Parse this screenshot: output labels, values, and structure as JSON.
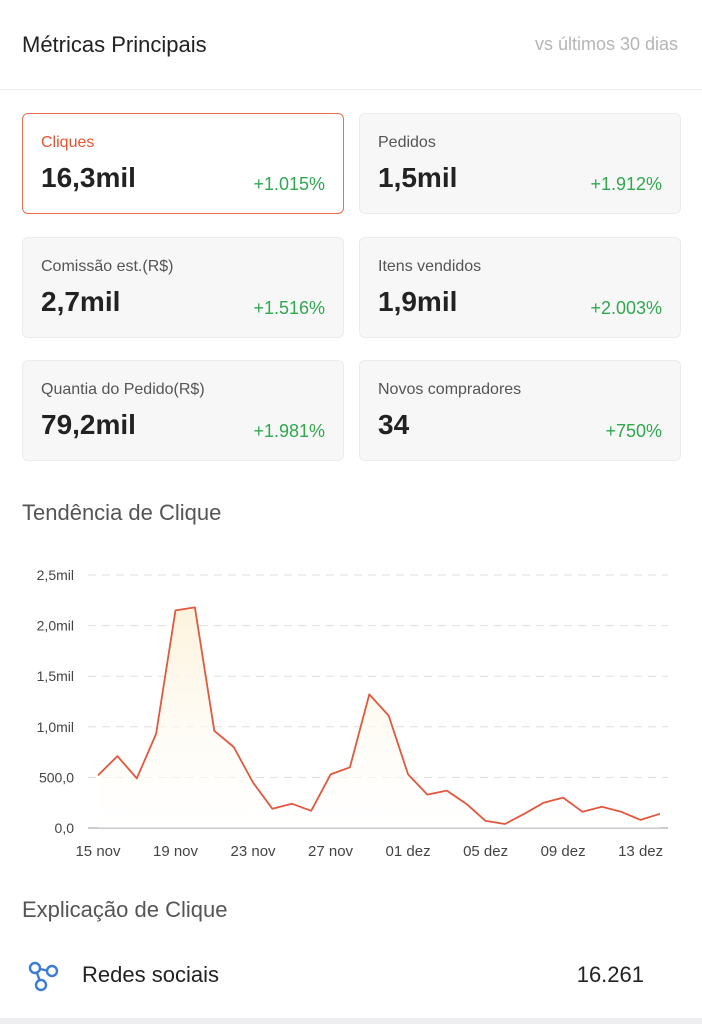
{
  "header": {
    "title": "Métricas Principais",
    "period": "vs últimos 30 dias"
  },
  "metrics": [
    {
      "label": "Cliques",
      "value": "16,3mil",
      "delta": "+1.015%",
      "active": true
    },
    {
      "label": "Pedidos",
      "value": "1,5mil",
      "delta": "+1.912%",
      "active": false
    },
    {
      "label": "Comissão est.(R$)",
      "value": "2,7mil",
      "delta": "+1.516%",
      "active": false
    },
    {
      "label": "Itens vendidos",
      "value": "1,9mil",
      "delta": "+2.003%",
      "active": false
    },
    {
      "label": "Quantia do Pedido(R$)",
      "value": "79,2mil",
      "delta": "+1.981%",
      "active": false
    },
    {
      "label": "Novos compradores",
      "value": "34",
      "delta": "+750%",
      "active": false
    }
  ],
  "trend": {
    "title": "Tendência de Clique"
  },
  "chart_data": {
    "type": "area",
    "title": "Tendência de Clique",
    "ylim": [
      0,
      2500
    ],
    "y_ticks": [
      {
        "value": 0,
        "label": "0,0"
      },
      {
        "value": 500,
        "label": "500,0"
      },
      {
        "value": 1000,
        "label": "1,0mil"
      },
      {
        "value": 1500,
        "label": "1,5mil"
      },
      {
        "value": 2000,
        "label": "2,0mil"
      },
      {
        "value": 2500,
        "label": "2,5mil"
      }
    ],
    "x_tick_labels": [
      "15 nov",
      "19 nov",
      "23 nov",
      "27 nov",
      "01 dez",
      "05 dez",
      "09 dez",
      "13 dez"
    ],
    "x_tick_index": [
      0,
      4,
      8,
      12,
      16,
      20,
      24,
      28
    ],
    "grid": true,
    "line_color": "#e2583e",
    "fill_color": "#fdf3dc",
    "series": [
      {
        "values": [
          520,
          710,
          490,
          930,
          2150,
          2180,
          960,
          800,
          450,
          190,
          240,
          170,
          530,
          600,
          1320,
          1110,
          530,
          330,
          370,
          240,
          70,
          40,
          140,
          250,
          300,
          160,
          210,
          160,
          80,
          140
        ]
      }
    ]
  },
  "explain": {
    "title": "Explicação de Clique",
    "row_label": "Redes sociais",
    "row_value": "16.261",
    "icon": "social-network-icon",
    "icon_color": "#3c7bd6"
  }
}
